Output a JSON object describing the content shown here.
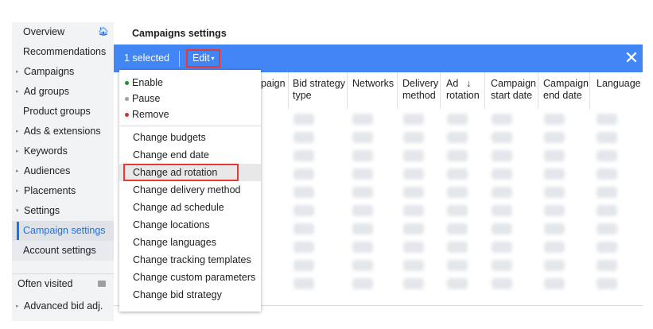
{
  "page_title": "Campaigns settings",
  "sidebar": {
    "items": [
      {
        "label": "Overview",
        "icon": "home-icon"
      },
      {
        "label": "Recommendations"
      },
      {
        "label": "Campaigns",
        "caret": "▸"
      },
      {
        "label": "Ad groups",
        "caret": "▸"
      },
      {
        "label": "Product groups"
      },
      {
        "label": "Ads & extensions",
        "caret": "▸"
      },
      {
        "label": "Keywords",
        "caret": "▸"
      },
      {
        "label": "Audiences",
        "caret": "▸"
      },
      {
        "label": "Placements",
        "caret": "▸"
      },
      {
        "label": "Settings",
        "caret": "▾"
      },
      {
        "label": "Campaign settings",
        "active": true
      },
      {
        "label": "Account settings"
      }
    ],
    "often_visited": "Often visited",
    "advanced_bid": {
      "label": "Advanced bid adj.",
      "caret": "▸"
    }
  },
  "selection_bar": {
    "count_text": "1 selected",
    "edit_label": "Edit",
    "edit_caret": "▾",
    "close_icon": "✕",
    "color": "#4285f4"
  },
  "table": {
    "columns": [
      {
        "label": "paign"
      },
      {
        "label": "Bid strategy type"
      },
      {
        "label": "Networks"
      },
      {
        "label": "Delivery method"
      },
      {
        "label": "Ad rotation",
        "sort_icon": "↓"
      },
      {
        "label": "Campaign start date"
      },
      {
        "label": "Campaign end date"
      },
      {
        "label": "Language"
      }
    ]
  },
  "edit_menu": {
    "status_items": [
      {
        "label": "Enable",
        "color": "#1e8e3e"
      },
      {
        "label": "Pause",
        "color": "#9aa0a6"
      },
      {
        "label": "Remove",
        "color": "#d93025"
      }
    ],
    "items": [
      {
        "label": "Change budgets"
      },
      {
        "label": "Change end date"
      },
      {
        "label": "Change ad rotation",
        "highlighted": true
      },
      {
        "label": "Change delivery method"
      },
      {
        "label": "Change ad schedule"
      },
      {
        "label": "Change locations"
      },
      {
        "label": "Change languages"
      },
      {
        "label": "Change tracking templates"
      },
      {
        "label": "Change custom parameters"
      },
      {
        "label": "Change bid strategy"
      }
    ]
  },
  "colors": {
    "accent": "#1a73e8",
    "highlight_border": "#e53935"
  }
}
